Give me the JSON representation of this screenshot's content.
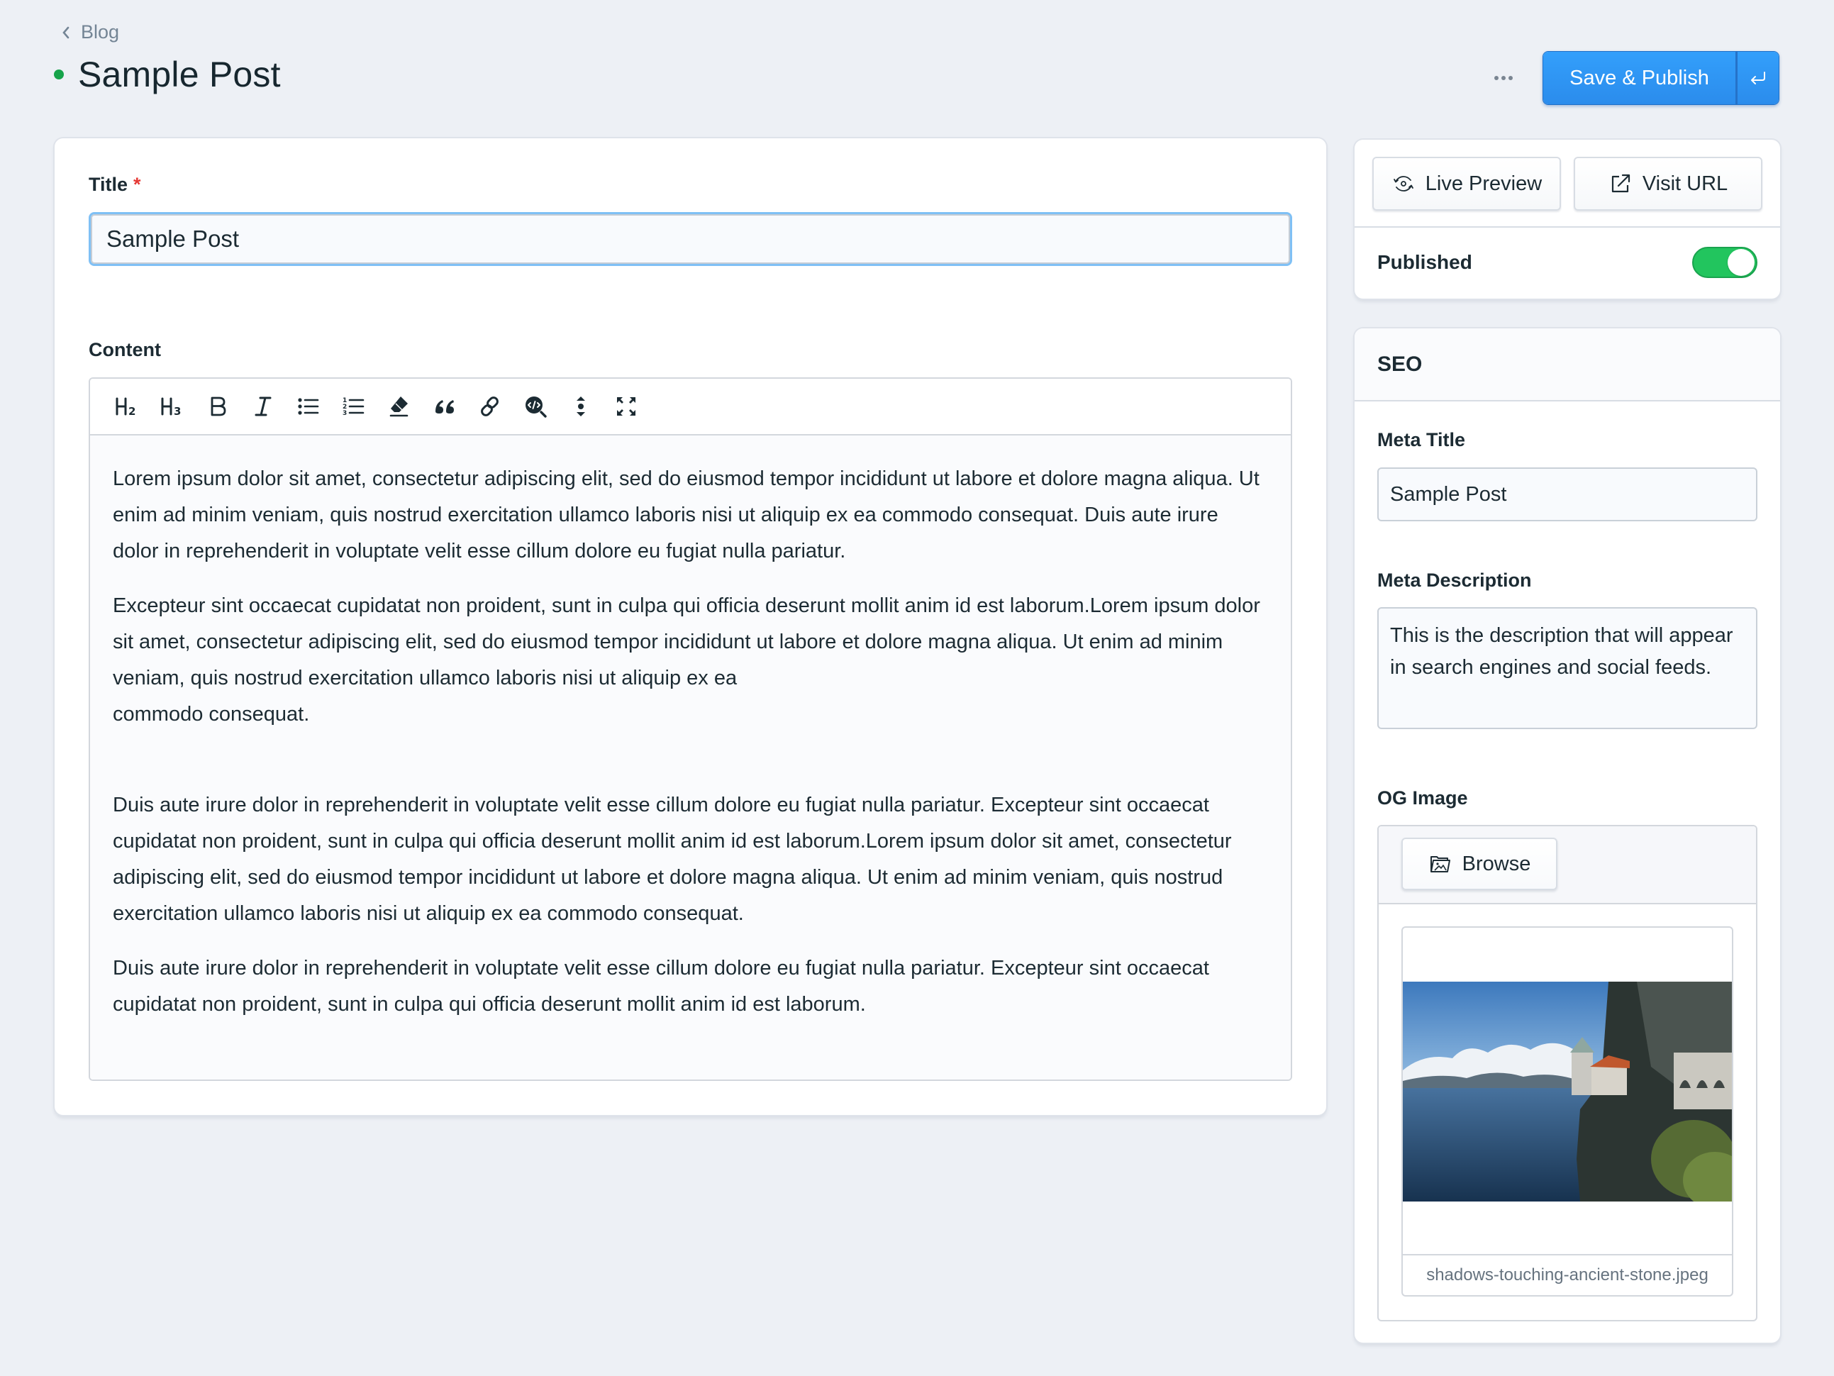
{
  "header": {
    "breadcrumb": "Blog",
    "title": "Sample Post",
    "status_color": "#16a34a",
    "more_icon": "more-horizontal-icon",
    "publish_label": "Save & Publish",
    "publish_menu_icon": "return-arrow-icon"
  },
  "form": {
    "title_label": "Title",
    "required_marker": "*",
    "title_value": "Sample Post",
    "content_label": "Content",
    "toolbar": [
      {
        "name": "heading-2",
        "icon": "h2-icon"
      },
      {
        "name": "heading-3",
        "icon": "h3-icon"
      },
      {
        "name": "bold",
        "icon": "bold-icon"
      },
      {
        "name": "italic",
        "icon": "italic-icon"
      },
      {
        "name": "bullet-list",
        "icon": "bullet-list-icon"
      },
      {
        "name": "ordered-list",
        "icon": "ordered-list-icon"
      },
      {
        "name": "clear-formatting",
        "icon": "eraser-icon"
      },
      {
        "name": "blockquote",
        "icon": "quote-icon"
      },
      {
        "name": "link",
        "icon": "link-icon"
      },
      {
        "name": "code-search",
        "icon": "code-search-icon"
      },
      {
        "name": "line-height",
        "icon": "expand-vertical-icon"
      },
      {
        "name": "fullscreen",
        "icon": "fullscreen-icon"
      }
    ],
    "paragraphs": [
      "Lorem ipsum dolor sit amet, consectetur adipiscing elit, sed do eiusmod tempor incididunt ut labore et dolore magna aliqua. Ut enim ad minim veniam, quis nostrud exercitation ullamco laboris nisi ut aliquip ex ea commodo consequat. Duis aute irure dolor in reprehenderit in voluptate velit esse cillum dolore eu fugiat nulla pariatur.",
      "Excepteur sint occaecat cupidatat non proident, sunt in culpa qui officia deserunt mollit anim id est laborum.Lorem ipsum dolor sit amet, consectetur adipiscing elit, sed do eiusmod tempor incididunt ut labore et dolore magna aliqua. Ut enim ad minim veniam, quis nostrud exercitation ullamco laboris nisi ut aliquip ex ea",
      "commodo consequat.",
      "Duis aute irure dolor in reprehenderit in voluptate velit esse cillum dolore eu fugiat nulla pariatur. Excepteur sint occaecat cupidatat non proident, sunt in culpa qui officia deserunt mollit anim id est laborum.Lorem ipsum dolor sit amet, consectetur adipiscing elit, sed do eiusmod tempor incididunt ut labore et dolore magna aliqua. Ut enim ad minim veniam, quis nostrud exercitation ullamco laboris nisi ut aliquip ex ea commodo consequat.",
      "Duis aute irure dolor in reprehenderit in voluptate velit esse cillum dolore eu fugiat nulla pariatur. Excepteur sint occaecat cupidatat non proident, sunt in culpa qui officia deserunt mollit anim id est laborum."
    ]
  },
  "sidebar": {
    "live_preview_label": "Live Preview",
    "visit_url_label": "Visit URL",
    "published_label": "Published",
    "published_on": true,
    "toggle_color": "#22c55e",
    "seo": {
      "heading": "SEO",
      "meta_title_label": "Meta Title",
      "meta_title_value": "Sample Post",
      "meta_description_label": "Meta Description",
      "meta_description_value": "This is the description that will appear in search engines and social feeds.",
      "og_image_label": "OG Image",
      "browse_label": "Browse",
      "og_image_filename": "shadows-touching-ancient-stone.jpeg"
    }
  },
  "colors": {
    "accent": "#2f96f5",
    "background": "#edf0f5",
    "required": "#e53935"
  }
}
